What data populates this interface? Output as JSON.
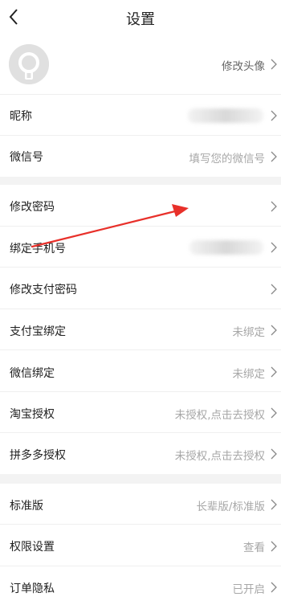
{
  "header": {
    "title": "设置"
  },
  "profile": {
    "avatar_label": "修改头像"
  },
  "rows1": {
    "nickname_label": "昵称",
    "wechat_id_label": "微信号",
    "wechat_id_placeholder": "填写您的微信号"
  },
  "rows2": {
    "change_password": "修改密码",
    "bind_phone": "绑定手机号",
    "change_pay_password": "修改支付密码",
    "alipay_bind_label": "支付宝绑定",
    "alipay_bind_value": "未绑定",
    "wechat_bind_label": "微信绑定",
    "wechat_bind_value": "未绑定",
    "taobao_auth_label": "淘宝授权",
    "taobao_auth_value": "未授权,点击去授权",
    "pdd_auth_label": "拼多多授权",
    "pdd_auth_value": "未授权,点击去授权"
  },
  "rows3": {
    "edition_label": "标准版",
    "edition_value": "长辈版/标准版",
    "permissions_label": "权限设置",
    "permissions_value": "查看",
    "order_privacy_label": "订单隐私",
    "order_privacy_value": "已开启"
  },
  "annotation": {
    "arrow_color": "#e8302a"
  },
  "colors": {
    "separator": "#f3f3f3",
    "secondary_text": "#a7a7a7"
  }
}
